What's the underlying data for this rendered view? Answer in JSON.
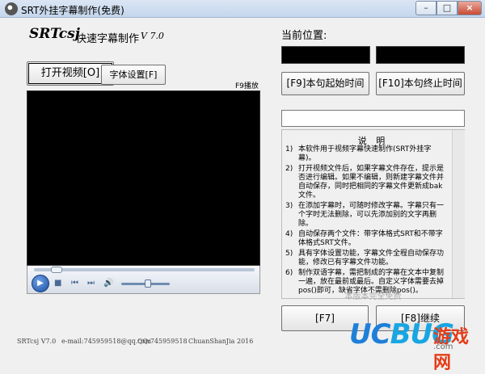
{
  "window": {
    "title": "SRT外挂字幕制作(免费)",
    "min_label": "–",
    "max_label": "□",
    "close_label": "×"
  },
  "header": {
    "brand": "SRTcsj",
    "subtitle": "快速字幕制作",
    "version": "V 7.0"
  },
  "toolbar": {
    "open_video": "打开视频[O]",
    "font_settings": "字体设置[F]",
    "f9_hint": "F9播放"
  },
  "player": {
    "play_glyph": "▶",
    "stop_glyph": "■",
    "prev_glyph": "⏮",
    "next_glyph": "⏭",
    "volume_glyph": "🔊",
    "seek_fraction": 0.08,
    "volume_fraction": 0.55
  },
  "position": {
    "label": "当前位置:"
  },
  "actions": {
    "start_time": "[F9]本句起始时间",
    "end_time": "[F10]本句终止时间",
    "f7": "[F7]",
    "f8": "[F8]继续"
  },
  "notes": {
    "title": "说 明",
    "items": [
      {
        "num": "1)",
        "text": "本软件用于视频字幕快速制作(SRT外挂字幕)。"
      },
      {
        "num": "2)",
        "text": "打开视频文件后，如果字幕文件存在，提示是否进行编辑。如果不编辑，则新建字幕文件并自动保存，同时把相同的字幕文件更新成bak文件。"
      },
      {
        "num": "3)",
        "text": "在添加字幕时，可随时修改字幕。字幕只有一个字时无法删除，可以先添加别的文字再删除。"
      },
      {
        "num": "4)",
        "text": "自动保存两个文件：带字体格式SRT和不带字体格式SRT文件。"
      },
      {
        "num": "5)",
        "text": "具有字体设置功能，字幕文件全程自动保存功能，修改已有字幕文件功能。"
      },
      {
        "num": "6)",
        "text": "制作双语字幕，需把制成的字幕在文本中复制一遍，放在最前或最后。自定义字体需要去掉pos()即可，缺省字体不需删除pos()。"
      }
    ],
    "free_label": "本版本完全免费"
  },
  "status": {
    "app": "SRTcsj V7.0",
    "email": "e-mail:745959518@qq.com",
    "qq": "QQ:745959518",
    "author": "ChuanShanJia 2016"
  },
  "watermark": {
    "uc": "UC",
    "bug": "BUG",
    "cn": "游戏网",
    "com": ".com"
  },
  "colors": {
    "title_gradient_top": "#dbe6f4",
    "close_red": "#c94b35",
    "watermark_blue": "#1f7fd8",
    "watermark_red": "#e53c17"
  }
}
